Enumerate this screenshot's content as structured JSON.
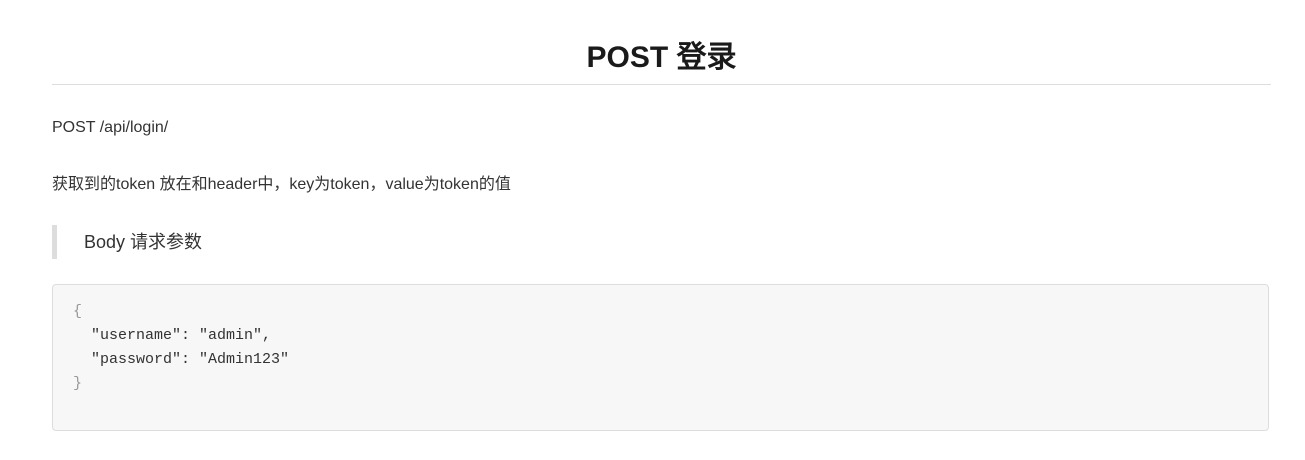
{
  "title": "POST 登录",
  "endpoint": "POST /api/login/",
  "description": "获取到的token 放在和header中，key为token，value为token的值",
  "blockquote": "Body 请求参数",
  "code": {
    "open_brace": "{",
    "line_username": "  \"username\": \"admin\",",
    "line_password": "  \"password\": \"Admin123\"",
    "close_brace": "}"
  }
}
